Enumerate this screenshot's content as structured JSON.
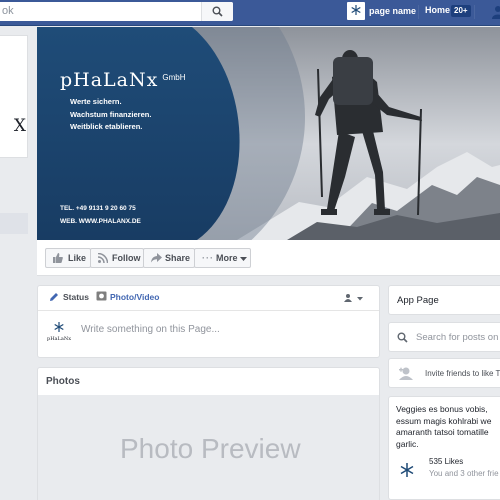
{
  "topbar": {
    "search_placeholder": "ok",
    "page_name": "page name",
    "home_label": "Home",
    "home_badge": "20+"
  },
  "profile": {
    "logo_fragment": "X"
  },
  "cover": {
    "brand_name": "pHaLaNx",
    "brand_suffix": "GmbH",
    "slogan": [
      "Werte sichern.",
      "Wachstum finanzieren.",
      "Weitblick etablieren."
    ],
    "phone": "TEL. +49 9131 9 20 60 75",
    "web": "WEB. WWW.PHALANX.DE",
    "colors": {
      "panel": "#1e4a76",
      "sky": "#c9ccd1"
    }
  },
  "actions": {
    "like": "Like",
    "follow": "Follow",
    "share": "Share",
    "more": "More"
  },
  "composer": {
    "status_tab": "Status",
    "photo_tab": "Photo/Video",
    "avatar_text": "pHaLaNx",
    "placeholder": "Write something on this Page..."
  },
  "photos": {
    "heading": "Photos",
    "preview_text": "Photo Preview"
  },
  "sidebar": {
    "app_page": "App Page",
    "search_placeholder": "Search for posts on",
    "invite": "Invite friends to like T",
    "about_lines": [
      "Veggies es bonus vobis,",
      "essum magis kohlrabi we",
      "amaranth tatsoi tomatille",
      "garlic."
    ],
    "likes_count": "535 Likes",
    "likes_friends": "You and 3 other frie"
  },
  "colors": {
    "facebook_blue": "#3b5998",
    "background": "#e9ebee"
  }
}
